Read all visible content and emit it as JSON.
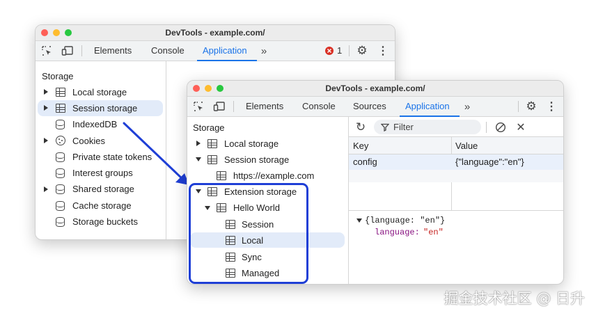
{
  "back_window": {
    "title": "DevTools - example.com/",
    "tabs": [
      "Elements",
      "Console",
      "Application"
    ],
    "active_tab": "Application",
    "error_count": "1",
    "sidebar_heading": "Storage",
    "items": [
      "Local storage",
      "Session storage",
      "IndexedDB",
      "Cookies",
      "Private state tokens",
      "Interest groups",
      "Shared storage",
      "Cache storage",
      "Storage buckets"
    ]
  },
  "front_window": {
    "title": "DevTools - example.com/",
    "tabs": [
      "Elements",
      "Console",
      "Sources",
      "Application"
    ],
    "active_tab": "Application",
    "sidebar_heading": "Storage",
    "items": [
      "Local storage",
      "Session storage",
      "https://example.com",
      "Extension storage",
      "Hello World",
      "Session",
      "Local",
      "Sync",
      "Managed"
    ],
    "filter_placeholder": "Filter",
    "table": {
      "headers": [
        "Key",
        "Value"
      ],
      "rows": [
        [
          "config",
          "{\"language\":\"en\"}"
        ]
      ]
    },
    "preview": {
      "root": "{language: \"en\"}",
      "key": "language",
      "value": "\"en\""
    }
  },
  "watermark": "掘金技术社区 @ 日升",
  "colors": {
    "accent": "#1a73e8",
    "highlight_border": "#1f3fd6",
    "selection": "#e2ebf9",
    "string": "#c5221f",
    "key": "#881280"
  }
}
